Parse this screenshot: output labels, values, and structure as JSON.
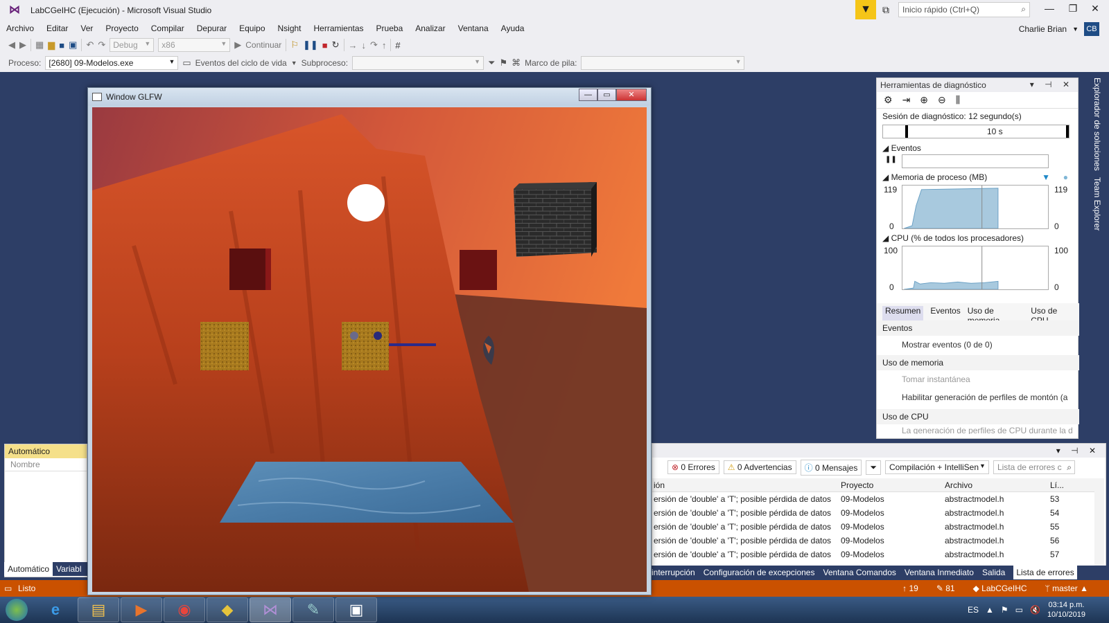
{
  "app": {
    "title": "LabCGeIHC (Ejecución) - Microsoft Visual Studio",
    "quick_launch_placeholder": "Inicio rápido (Ctrl+Q)",
    "user": "Charlie Brian",
    "user_initials": "CB"
  },
  "menu": [
    "Archivo",
    "Editar",
    "Ver",
    "Proyecto",
    "Compilar",
    "Depurar",
    "Equipo",
    "Nsight",
    "Herramientas",
    "Prueba",
    "Analizar",
    "Ventana",
    "Ayuda"
  ],
  "toolbar": {
    "config": "Debug",
    "platform": "x86",
    "continue_label": "Continuar",
    "process_label": "Proceso:",
    "process_value": "[2680] 09-Modelos.exe",
    "lifecycle_label": "Eventos del ciclo de vida",
    "thread_label": "Subproceso:",
    "stackframe_label": "Marco de pila:"
  },
  "glfw": {
    "title": "Window GLFW"
  },
  "autos": {
    "title": "Automático",
    "column": "Nombre",
    "tabs": [
      "Automático",
      "Variabl"
    ]
  },
  "diag": {
    "title": "Herramientas de diagnóstico",
    "session": "Sesión de diagnóstico: 12 segundo(s)",
    "timeline_tick": "10 s",
    "events_header": "Eventos",
    "memory_header": "Memoria de proceso (MB)",
    "memory_max": "119",
    "memory_min": "0",
    "cpu_header": "CPU (% de todos los procesadores)",
    "cpu_max": "100",
    "cpu_min": "0",
    "tabs": [
      "Resumen",
      "Eventos",
      "Uso de memoria",
      "Uso de CPU"
    ],
    "sec_events": "Eventos",
    "show_events": "Mostrar eventos (0 de 0)",
    "sec_memory": "Uso de memoria",
    "snapshot": "Tomar instantánea",
    "heap_profiling": "Habilitar generación de perfiles de montón (a",
    "sec_cpu": "Uso de CPU",
    "cpu_item": "La generación de perfiles de CPU durante la d"
  },
  "side_tabs": [
    "Explorador de soluciones",
    "Team Explorer"
  ],
  "errors": {
    "errors_btn": "0 Errores",
    "warnings_btn": "0 Advertencias",
    "messages_btn": "0 Mensajes",
    "build_filter": "Compilación + IntelliSen",
    "search_placeholder": "Lista de errores c",
    "columns": [
      "ión",
      "Proyecto",
      "Archivo",
      "Lí..."
    ],
    "rows": [
      {
        "desc": "ersión de 'double' a 'T'; posible pérdida de datos",
        "project": "09-Modelos",
        "file": "abstractmodel.h",
        "line": "53"
      },
      {
        "desc": "ersión de 'double' a 'T'; posible pérdida de datos",
        "project": "09-Modelos",
        "file": "abstractmodel.h",
        "line": "54"
      },
      {
        "desc": "ersión de 'double' a 'T'; posible pérdida de datos",
        "project": "09-Modelos",
        "file": "abstractmodel.h",
        "line": "55"
      },
      {
        "desc": "ersión de 'double' a 'T'; posible pérdida de datos",
        "project": "09-Modelos",
        "file": "abstractmodel.h",
        "line": "56"
      },
      {
        "desc": "ersión de 'double' a 'T'; posible pérdida de datos",
        "project": "09-Modelos",
        "file": "abstractmodel.h",
        "line": "57"
      }
    ]
  },
  "bottom_tabs": [
    "interrupción",
    "Configuración de excepciones",
    "Ventana Comandos",
    "Ventana Inmediato",
    "Salida",
    "Lista de errores"
  ],
  "status": {
    "ready": "Listo",
    "up": "19",
    "edits": "81",
    "repo": "LabCGeIHC",
    "branch": "master"
  },
  "taskbar": {
    "lang": "ES",
    "time": "03:14 p.m.",
    "date": "10/10/2019"
  },
  "colors": {
    "accent": "#ca5100",
    "vs_purple": "#68217a",
    "ide_bg": "#2d3e66"
  }
}
